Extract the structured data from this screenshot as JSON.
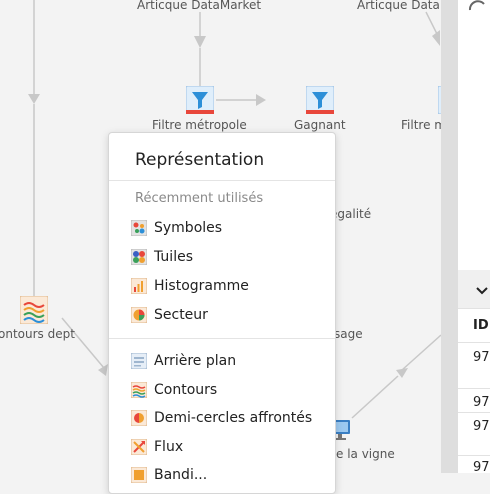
{
  "canvas": {
    "nodes": {
      "datamarket1": "Articque DataMarket",
      "datamarket2": "Articque DataMarket",
      "filtre_metropole": "Filtre métropole",
      "gagnant": "Gagnant",
      "filtre_right": "Filtre m",
      "egalite": "egalité",
      "contours_dept": "ontours dept",
      "sage": "sage",
      "la_vigne": "e la vigne"
    }
  },
  "menu": {
    "title": "Représentation",
    "section_recent": "Récemment utilisés",
    "recent_items": [
      {
        "label": "Symboles",
        "icon": "symbols-icon"
      },
      {
        "label": "Tuiles",
        "icon": "tiles-icon"
      },
      {
        "label": "Histogramme",
        "icon": "histogram-icon"
      },
      {
        "label": "Secteur",
        "icon": "sector-icon"
      }
    ],
    "all_items": [
      {
        "label": "Arrière plan",
        "icon": "background-icon"
      },
      {
        "label": "Contours",
        "icon": "contours-icon"
      },
      {
        "label": "Demi-cercles affrontés",
        "icon": "half-circles-icon"
      },
      {
        "label": "Flux",
        "icon": "flux-icon"
      },
      {
        "label": "Bandi...",
        "icon": "partial-icon"
      }
    ]
  },
  "right_panel": {
    "header_icon": "chevron-down-icon",
    "column_header": "ID",
    "rows": [
      "97",
      "97",
      "97",
      "97"
    ]
  },
  "colors": {
    "canvas_bg": "#f3f3f3",
    "link": "#c8c8c8",
    "filter_blue": "#2c8fd8",
    "accent_red": "#e8473b"
  }
}
